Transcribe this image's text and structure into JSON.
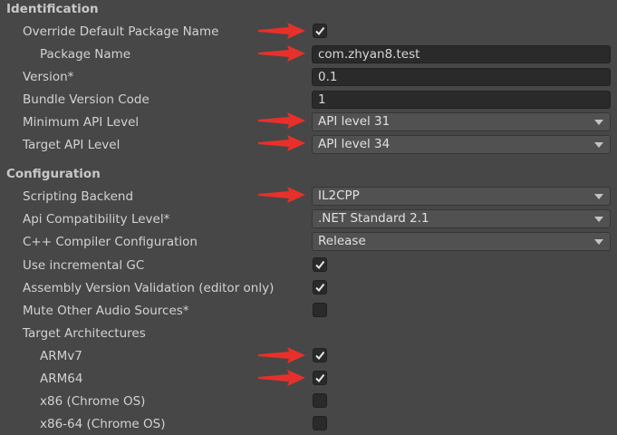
{
  "identification": {
    "title": "Identification",
    "override_label": "Override Default Package Name",
    "override_checked": true,
    "package_label": "Package Name",
    "package_value": "com.zhyan8.test",
    "version_label": "Version*",
    "version_value": "0.1",
    "bundle_label": "Bundle Version Code",
    "bundle_value": "1",
    "minapi_label": "Minimum API Level",
    "minapi_value": "API level 31",
    "targetapi_label": "Target API Level",
    "targetapi_value": "API level 34"
  },
  "configuration": {
    "title": "Configuration",
    "backend_label": "Scripting Backend",
    "backend_value": "IL2CPP",
    "apicompat_label": "Api Compatibility Level*",
    "apicompat_value": ".NET Standard 2.1",
    "cpp_label": "C++ Compiler Configuration",
    "cpp_value": "Release",
    "incgc_label": "Use incremental GC",
    "incgc_checked": true,
    "asmval_label": "Assembly Version Validation (editor only)",
    "asmval_checked": true,
    "mute_label": "Mute Other Audio Sources*",
    "mute_checked": false,
    "arch_label": "Target Architectures",
    "armv7_label": "ARMv7",
    "armv7_checked": true,
    "arm64_label": "ARM64",
    "arm64_checked": true,
    "x86_label": "x86 (Chrome OS)",
    "x86_checked": false,
    "x8664_label": "x86-64 (Chrome OS)",
    "x8664_checked": false
  },
  "colors": {
    "annotation_arrow": "#e8302a"
  }
}
